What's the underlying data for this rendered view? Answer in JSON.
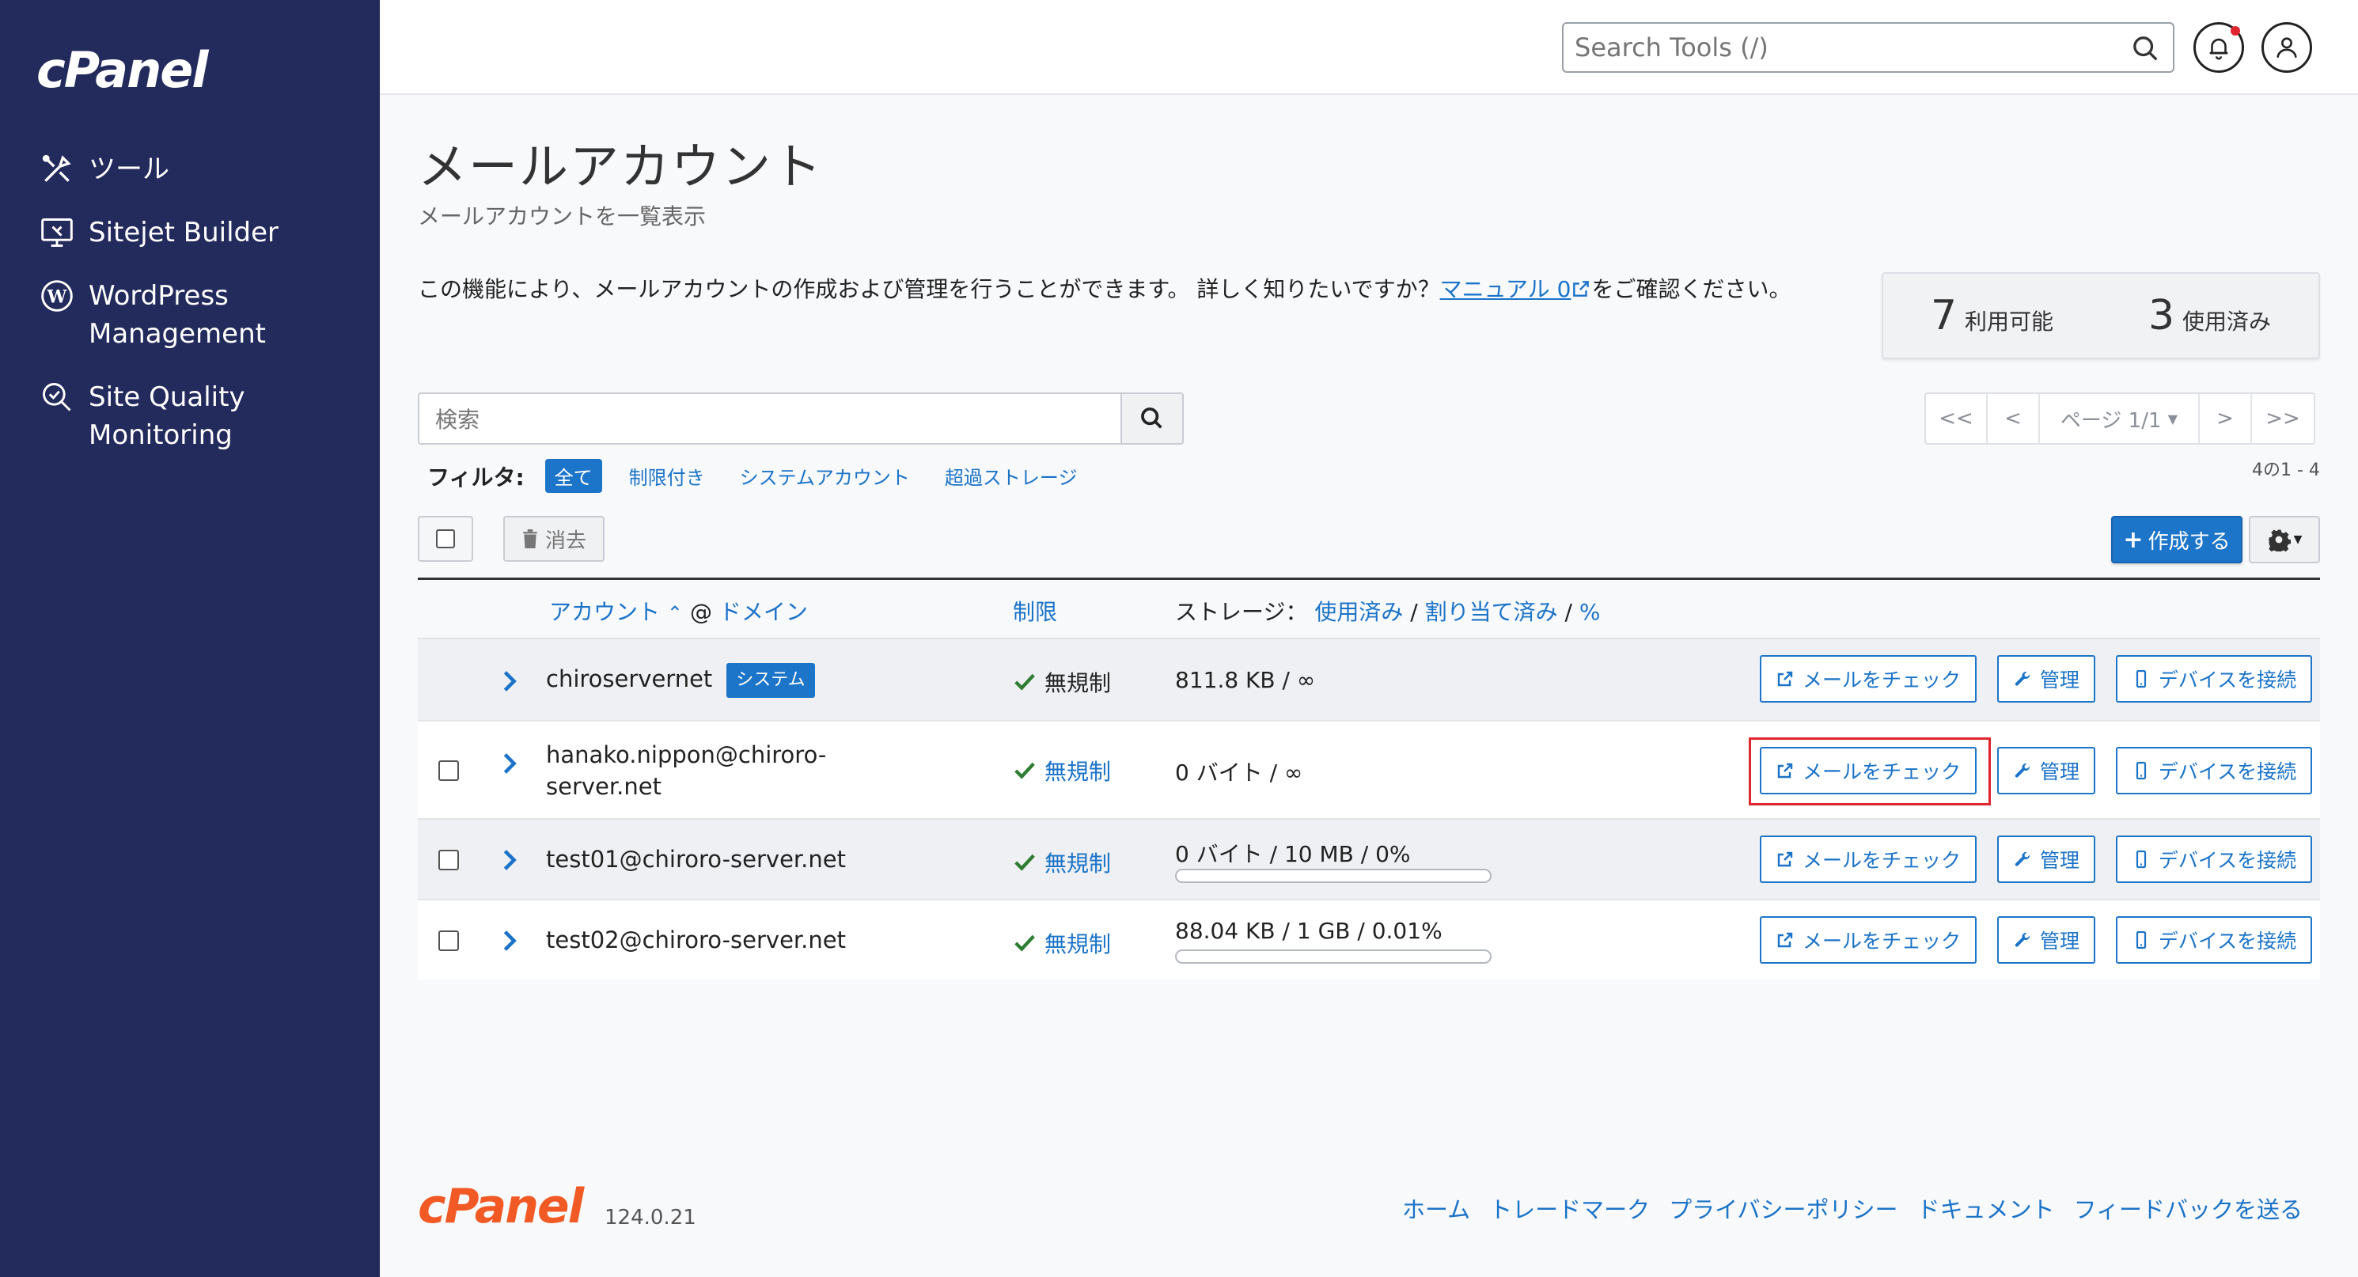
{
  "sidebar": {
    "logo": "cPanel",
    "items": [
      {
        "label": "ツール"
      },
      {
        "label": "Sitejet Builder"
      },
      {
        "label": "WordPress",
        "label2": "Management"
      },
      {
        "label": "Site Quality",
        "label2": "Monitoring"
      }
    ]
  },
  "header": {
    "search_placeholder": "Search Tools (/)"
  },
  "page": {
    "title": "メールアカウント",
    "subtitle": "メールアカウントを一覧表示",
    "intro_text": "この機能により、メールアカウントの作成および管理を行うことができます。 詳しく知りたいですか？",
    "intro_link": "マニュアル 0",
    "intro_suffix": "をご確認ください。"
  },
  "stats": {
    "available_num": "7",
    "available_label": "利用可能",
    "used_num": "3",
    "used_label": "使用済み"
  },
  "search": {
    "placeholder": "検索"
  },
  "pager": {
    "first": "<<",
    "prev": "<",
    "page": "ページ 1/1",
    "next": ">",
    "last": ">>",
    "count": "4の1 - 4"
  },
  "filters": {
    "label": "フィルタ:",
    "all": "全て",
    "restricted": "制限付き",
    "system": "システムアカウント",
    "over_storage": "超過ストレージ"
  },
  "toolbar": {
    "delete": "消去",
    "create": "作成する"
  },
  "table": {
    "col_account": "アカウント",
    "col_at": "@",
    "col_domain": "ドメイン",
    "col_limit": "制限",
    "col_storage": "ストレージ：",
    "col_used": "使用済み",
    "col_sep1": "/",
    "col_alloc": "割り当て済み",
    "col_sep2": "/",
    "col_pct": "%",
    "btn_check": "メールをチェック",
    "btn_manage": "管理",
    "btn_connect": "デバイスを接続",
    "rows": [
      {
        "account": "chiroservernet",
        "badge": "システム",
        "limit": "無規制",
        "storage": "811.8 KB / ∞"
      },
      {
        "account": "hanako.nippon@chiroro-",
        "account2": "server.net",
        "limit": "無規制",
        "storage": "0 バイト / ∞"
      },
      {
        "account": "test01@chiroro-server.net",
        "limit": "無規制",
        "storage": "0 バイト / 10 MB / 0%",
        "usage_fraction": 0
      },
      {
        "account": "test02@chiroro-server.net",
        "limit": "無規制",
        "storage": "88.04 KB / 1 GB / 0.01%",
        "usage_fraction": 0.0001
      }
    ]
  },
  "footer": {
    "logo": "cPanel",
    "version": "124.0.21",
    "links": [
      "ホーム",
      "トレードマーク",
      "プライバシーポリシー",
      "ドキュメント",
      "フィードバックを送る"
    ]
  },
  "colors": {
    "sidebar_bg": "#232a5c",
    "accent": "#1d75c9",
    "footer_logo": "#f15a24",
    "highlight": "#e0252f"
  }
}
